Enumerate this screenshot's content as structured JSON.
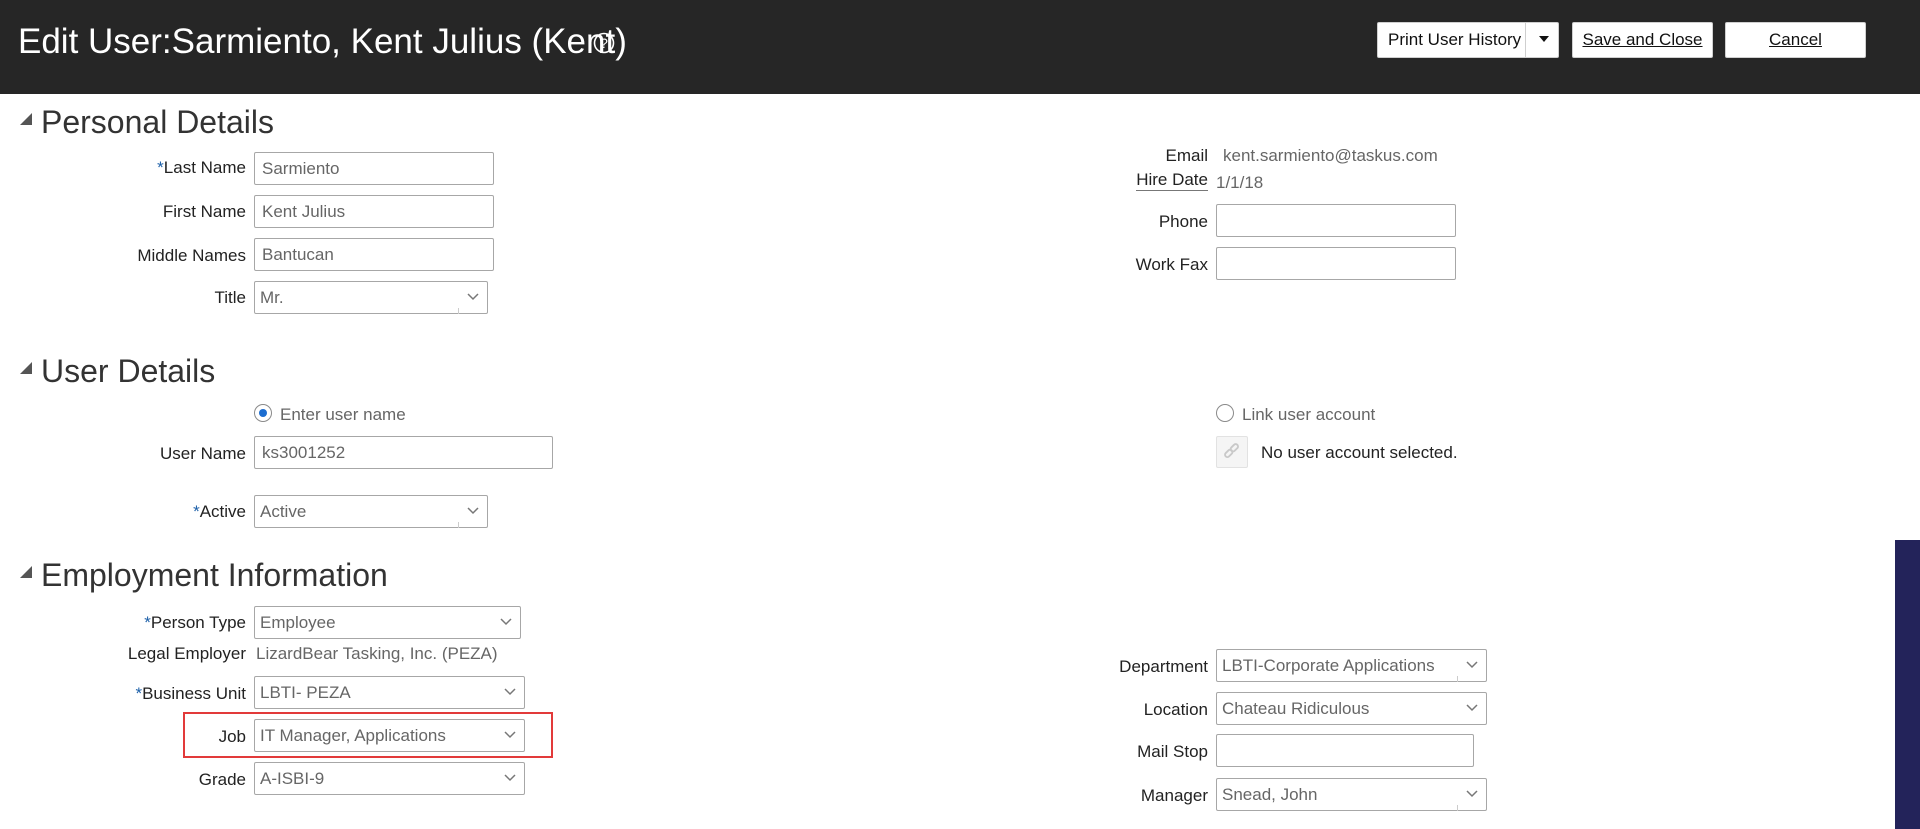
{
  "header": {
    "title": "Edit User:Sarmiento, Kent Julius (Kent)",
    "help_icon": "question-circle-icon",
    "print_history_label": "Print User History",
    "save_close_label": "Save and Close",
    "cancel_label": "Cancel"
  },
  "personal_details": {
    "section_title": "Personal Details",
    "last_name_label": "Last Name",
    "last_name_value": "Sarmiento",
    "first_name_label": "First Name",
    "first_name_value": "Kent Julius",
    "middle_names_label": "Middle Names",
    "middle_names_value": "Bantucan",
    "title_label": "Title",
    "title_value": "Mr.",
    "email_label": "Email",
    "email_value": "kent.sarmiento@taskus.com",
    "hire_date_label": "Hire Date",
    "hire_date_value": "1/1/18",
    "phone_label": "Phone",
    "phone_value": "",
    "work_fax_label": "Work Fax",
    "work_fax_value": ""
  },
  "user_details": {
    "section_title": "User Details",
    "enter_user_name_label": "Enter user name",
    "link_user_account_label": "Link user account",
    "user_name_label": "User Name",
    "user_name_value": "ks3001252",
    "no_account_text": "No user account selected.",
    "active_label": "Active",
    "active_value": "Active"
  },
  "employment_info": {
    "section_title": "Employment Information",
    "person_type_label": "Person Type",
    "person_type_value": "Employee",
    "legal_employer_label": "Legal Employer",
    "legal_employer_value": "LizardBear Tasking, Inc. (PEZA)",
    "business_unit_label": "Business Unit",
    "business_unit_value": "LBTI- PEZA",
    "job_label": "Job",
    "job_value": "IT Manager, Applications",
    "grade_label": "Grade",
    "grade_value": "A-ISBI-9",
    "department_label": "Department",
    "department_value": "LBTI-Corporate Applications",
    "location_label": "Location",
    "location_value": "Chateau Ridiculous",
    "mail_stop_label": "Mail Stop",
    "mail_stop_value": "",
    "manager_label": "Manager",
    "manager_value": "Snead, John"
  },
  "required_marker": "*",
  "colors": {
    "header_bg": "#262626",
    "required": "#1c5fa8",
    "highlight": "#e23a3a",
    "scrollbar_thumb": "#23235a"
  }
}
